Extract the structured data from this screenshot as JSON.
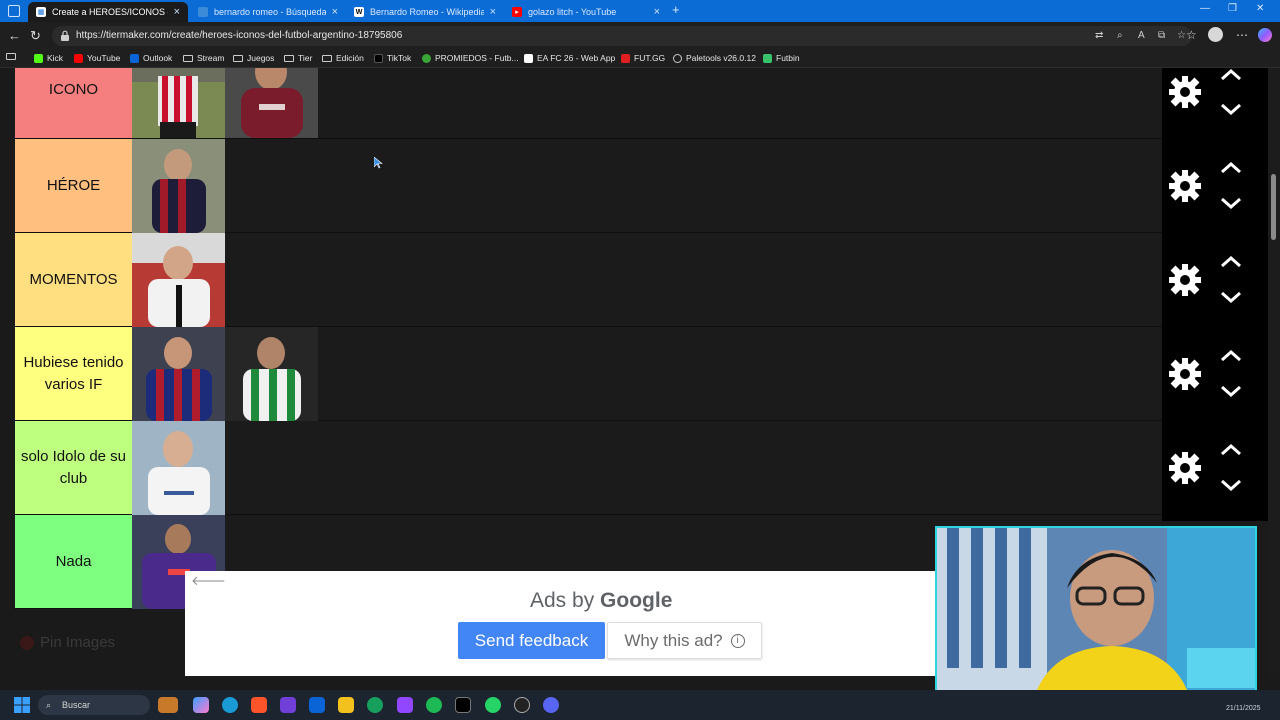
{
  "browser": {
    "tabs": [
      {
        "label": "Create a HEROES/ICONOS del FÚ",
        "active": true,
        "favicon": "tiermaker-icon",
        "color": "#0b6cd6"
      },
      {
        "label": "bernardo romeo - Búsqueda",
        "active": false,
        "favicon": "bing-icon",
        "color": "#3b8bd8"
      },
      {
        "label": "Bernardo Romeo - Wikipedia, la e",
        "active": false,
        "favicon": "wikipedia-icon",
        "color": "#ffffff"
      },
      {
        "label": "golazo litch - YouTube",
        "active": false,
        "favicon": "youtube-icon",
        "color": "#ff0000"
      }
    ],
    "url": "https://tiermaker.com/create/heroes-iconos-del-futbol-argentino-18795806"
  },
  "bookmarks": [
    {
      "label": "Kick",
      "icon": "kick-icon",
      "color": "#53fc18"
    },
    {
      "label": "YouTube",
      "icon": "youtube-icon",
      "color": "#ff0000"
    },
    {
      "label": "Outlook",
      "icon": "outlook-icon",
      "color": "#0a64d6"
    },
    {
      "label": "Stream",
      "icon": "folder-icon",
      "color": ""
    },
    {
      "label": "Juegos",
      "icon": "folder-icon",
      "color": ""
    },
    {
      "label": "Tier",
      "icon": "folder-icon",
      "color": ""
    },
    {
      "label": "Edición",
      "icon": "folder-icon",
      "color": ""
    },
    {
      "label": "TikTok",
      "icon": "tiktok-icon",
      "color": "#000000"
    },
    {
      "label": "PROMIEDOS - Futb...",
      "icon": "promiedos-icon",
      "color": "#3aa635"
    },
    {
      "label": "EA FC 26 - Web App",
      "icon": "ea-icon",
      "color": "#ffffff"
    },
    {
      "label": "FUT.GG",
      "icon": "futgg-icon",
      "color": "#e02020"
    },
    {
      "label": "Paletools v26.0.12",
      "icon": "globe-icon",
      "color": "#cccccc"
    },
    {
      "label": "Futbin",
      "icon": "futbin-icon",
      "color": "#37c26b"
    }
  ],
  "tiers": [
    {
      "label": "ICONO",
      "color": "#f57f7f",
      "items": 2
    },
    {
      "label": "HÉROE",
      "color": "#ffbf7f",
      "items": 1
    },
    {
      "label": "MOMENTOS",
      "color": "#ffdf80",
      "items": 1
    },
    {
      "label": "Hubiese tenido varios IF",
      "color": "#ffff7f",
      "items": 2
    },
    {
      "label": "solo Idolo de su club",
      "color": "#bfff7f",
      "items": 1
    },
    {
      "label": "Nada",
      "color": "#7fff7f",
      "items": 1
    }
  ],
  "ad": {
    "ads_by": "Ads by",
    "brand": "Google",
    "feedback": "Send feedback",
    "why": "Why this ad?",
    "info_glyph": "i"
  },
  "pin_images": "Pin Images",
  "taskbar": {
    "search": "Buscar",
    "date": "21/11/2025"
  }
}
